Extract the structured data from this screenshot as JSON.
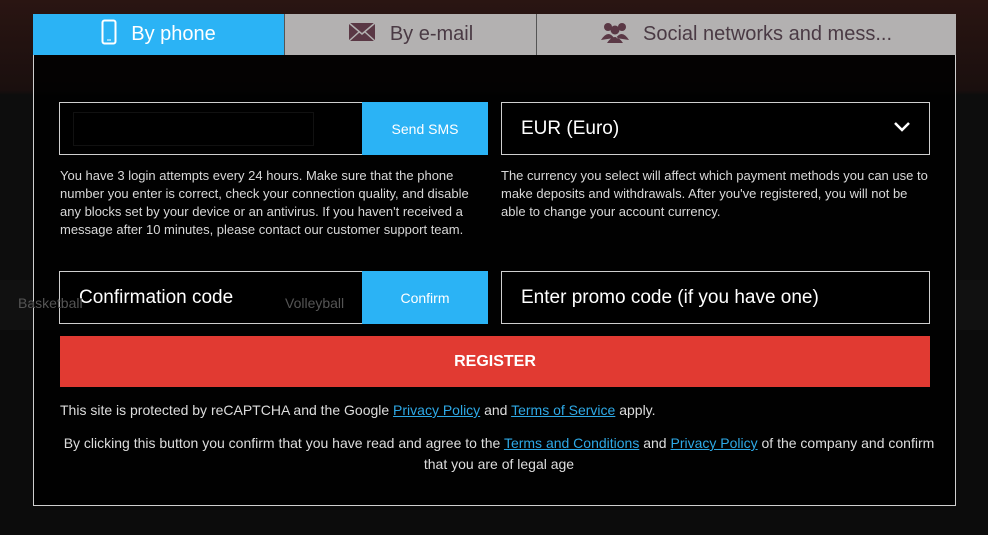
{
  "tabs": [
    {
      "label": "By phone",
      "icon": "phone-icon",
      "active": true
    },
    {
      "label": "By e-mail",
      "icon": "envelope-icon"
    },
    {
      "label": "Social networks and mess...",
      "icon": "users-icon"
    }
  ],
  "phone": {
    "value_redacted": true,
    "send_sms": "Send SMS",
    "help": "You have 3 login attempts every 24 hours. Make sure that the phone number you enter is correct, check your connection quality, and disable any blocks set by your device or an antivirus. If you haven't received a message after 10 minutes, please contact our customer support team."
  },
  "currency": {
    "value": "EUR (Euro)",
    "help": "The currency you select will affect which payment methods you can use to make deposits and withdrawals. After you've registered, you will not be able to change your account currency."
  },
  "confirmation": {
    "placeholder": "Confirmation code",
    "button": "Confirm"
  },
  "promo": {
    "placeholder": "Enter promo code (if you have one)"
  },
  "register": "REGISTER",
  "recaptcha": {
    "pre": "This site is protected by reCAPTCHA and the Google ",
    "privacy": "Privacy Policy",
    "and": " and ",
    "terms": "Terms of Service",
    "post": " apply."
  },
  "agree": {
    "pre": "By clicking this button you confirm that you have read and agree to the ",
    "terms": "Terms and Conditions",
    "and": " and ",
    "privacy": "Privacy Policy",
    "post": " of the company and confirm that you are of legal age"
  },
  "background": {
    "items": [
      "Basketball",
      "Volleyball"
    ]
  },
  "colors": {
    "accent": "#2bb3f5",
    "register": "#e13a32",
    "tab_inactive": "#b3b1b1"
  }
}
